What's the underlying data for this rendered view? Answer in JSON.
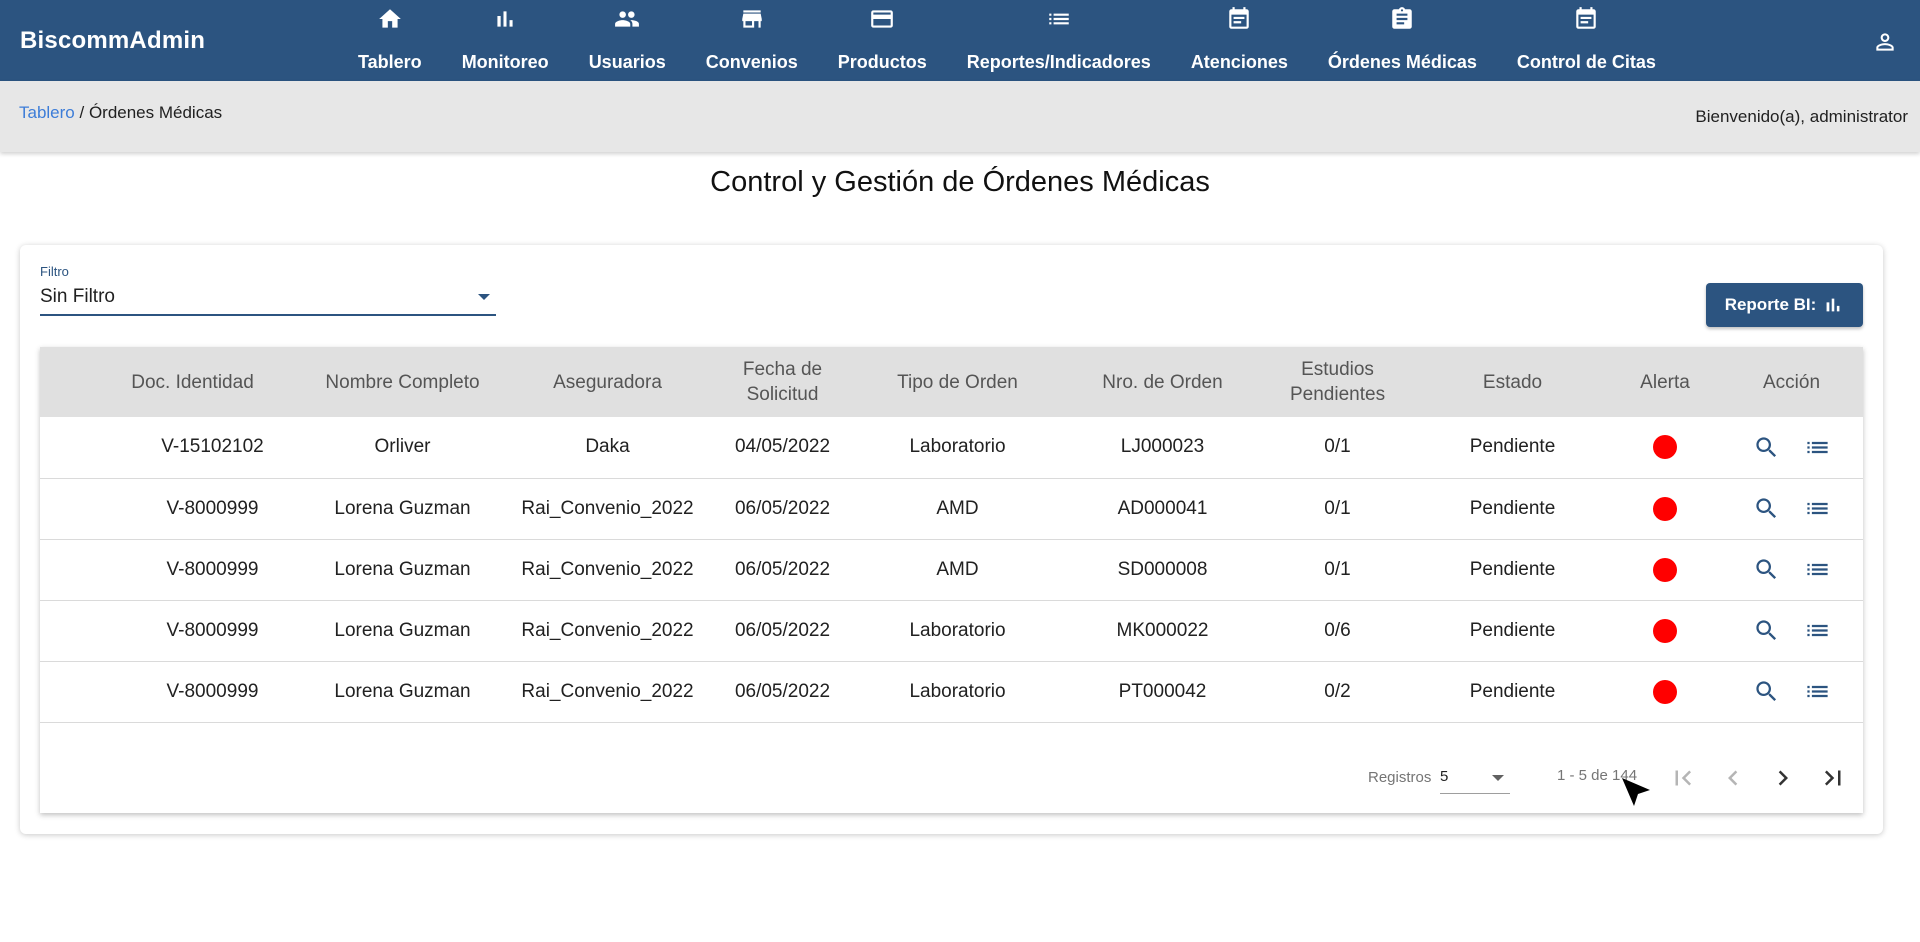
{
  "app": {
    "brand": "BiscommAdmin"
  },
  "nav": {
    "items": [
      {
        "label": "Tablero",
        "icon": "home-icon"
      },
      {
        "label": "Monitoreo",
        "icon": "bar-chart-icon"
      },
      {
        "label": "Usuarios",
        "icon": "people-icon"
      },
      {
        "label": "Convenios",
        "icon": "store-icon"
      },
      {
        "label": "Productos",
        "icon": "credit-card-icon"
      },
      {
        "label": "Reportes/Indicadores",
        "icon": "list-icon"
      },
      {
        "label": "Atenciones",
        "icon": "event-note-icon"
      },
      {
        "label": "Órdenes Médicas",
        "icon": "assignment-icon"
      },
      {
        "label": "Control de Citas",
        "icon": "event-note-icon"
      }
    ],
    "user_icon": "account-icon"
  },
  "breadcrumb": {
    "parent": "Tablero",
    "separator": " / ",
    "current": "Órdenes Médicas"
  },
  "welcome": "Bienvenido(a), administrator",
  "page_title": "Control y Gestión de Órdenes Médicas",
  "filter": {
    "label": "Filtro",
    "value": "Sin Filtro"
  },
  "report_button": {
    "label": "Reporte BI:",
    "icon": "bar-chart-icon"
  },
  "table": {
    "headers": [
      "Doc. Identidad",
      "Nombre Completo",
      "Aseguradora",
      "Fecha de Solicitud",
      "Tipo de Orden",
      "Nro. de Orden",
      "Estudios Pendientes",
      "Estado",
      "Alerta",
      "Acción"
    ],
    "rows": [
      {
        "doc": "V-15102102",
        "name": "Orliver",
        "insurer": "Daka",
        "date": "04/05/2022",
        "type": "Laboratorio",
        "order": "LJ000023",
        "pending": "0/1",
        "status": "Pendiente",
        "alert_color": "#ff0000"
      },
      {
        "doc": "V-8000999",
        "name": "Lorena Guzman",
        "insurer": "Rai_Convenio_2022",
        "date": "06/05/2022",
        "type": "AMD",
        "order": "AD000041",
        "pending": "0/1",
        "status": "Pendiente",
        "alert_color": "#ff0000"
      },
      {
        "doc": "V-8000999",
        "name": "Lorena Guzman",
        "insurer": "Rai_Convenio_2022",
        "date": "06/05/2022",
        "type": "AMD",
        "order": "SD000008",
        "pending": "0/1",
        "status": "Pendiente",
        "alert_color": "#ff0000"
      },
      {
        "doc": "V-8000999",
        "name": "Lorena Guzman",
        "insurer": "Rai_Convenio_2022",
        "date": "06/05/2022",
        "type": "Laboratorio",
        "order": "MK000022",
        "pending": "0/6",
        "status": "Pendiente",
        "alert_color": "#ff0000"
      },
      {
        "doc": "V-8000999",
        "name": "Lorena Guzman",
        "insurer": "Rai_Convenio_2022",
        "date": "06/05/2022",
        "type": "Laboratorio",
        "order": "PT000042",
        "pending": "0/2",
        "status": "Pendiente",
        "alert_color": "#ff0000"
      }
    ],
    "action_icons": [
      "search-icon",
      "list-icon"
    ]
  },
  "paginator": {
    "rows_label": "Registros",
    "rows_value": "5",
    "range": "1 - 5 de 144"
  },
  "colors": {
    "navbar": "#2c5480",
    "accent": "#2c5480",
    "link": "#3d7dd8",
    "alert": "#ff0000"
  }
}
